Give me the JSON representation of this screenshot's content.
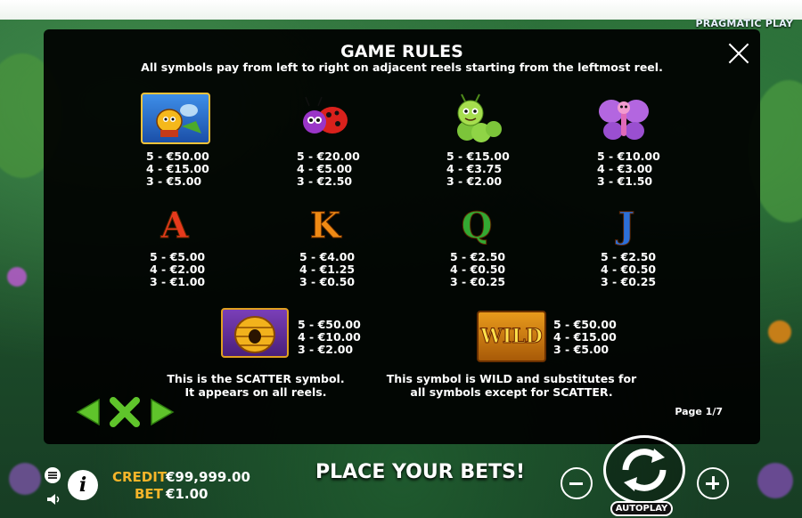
{
  "brand": "PRAGMATIC PLAY",
  "rules": {
    "title": "GAME RULES",
    "subtitle": "All symbols pay from left to right on adjacent reels starting from the leftmost reel.",
    "page": "Page 1/7"
  },
  "symbols_row1": [
    {
      "icon": "bee-icon",
      "pays": [
        "5 - €50.00",
        "4 - €15.00",
        "3 - €5.00"
      ]
    },
    {
      "icon": "ladybug-icon",
      "pays": [
        "5 - €20.00",
        "4 - €5.00",
        "3 - €2.50"
      ]
    },
    {
      "icon": "caterpillar-icon",
      "pays": [
        "5 - €15.00",
        "4 - €3.75",
        "3 - €2.00"
      ]
    },
    {
      "icon": "butterfly-icon",
      "pays": [
        "5 - €10.00",
        "4 - €3.00",
        "3 - €1.50"
      ]
    }
  ],
  "symbols_row2": [
    {
      "letter": "A",
      "color": "#e83a1c",
      "pays": [
        "5 - €5.00",
        "4 - €2.00",
        "3 - €1.00"
      ]
    },
    {
      "letter": "K",
      "color": "#f08a14",
      "pays": [
        "5 - €4.00",
        "4 - €1.25",
        "3 - €0.50"
      ]
    },
    {
      "letter": "Q",
      "color": "#33a832",
      "pays": [
        "5 - €2.50",
        "4 - €0.50",
        "3 - €0.25"
      ]
    },
    {
      "letter": "J",
      "color": "#2c6fd8",
      "pays": [
        "5 - €2.50",
        "4 - €0.50",
        "3 - €0.25"
      ]
    }
  ],
  "scatter": {
    "icon": "beehive-scatter-icon",
    "pays": [
      "5 - €50.00",
      "4 - €10.00",
      "3 - €2.00"
    ],
    "desc1": "This is the SCATTER symbol.",
    "desc2": "It appears on all reels."
  },
  "wild": {
    "label": "WILD",
    "pays": [
      "5 - €50.00",
      "4 - €15.00",
      "3 - €5.00"
    ],
    "desc1": "This symbol is WILD and substitutes for",
    "desc2": "all symbols except for SCATTER."
  },
  "footer": {
    "credit_label": "CREDIT",
    "credit_value": "€99,999.00",
    "bet_label": "BET",
    "bet_value": "€1.00",
    "message": "PLACE YOUR BETS!",
    "autoplay": "AUTOPLAY"
  },
  "colors": {
    "accent_gold": "#f6b52a",
    "nav_green": "#5fc42b",
    "modal_bg": "#000000"
  }
}
